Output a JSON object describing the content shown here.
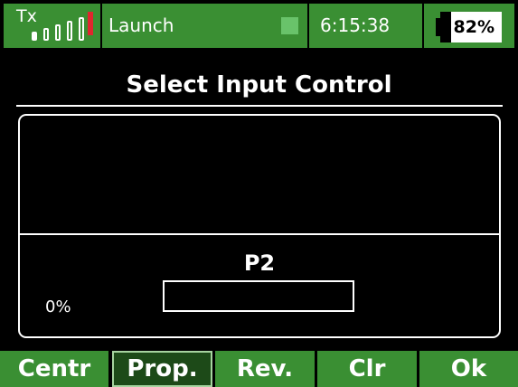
{
  "status_bar": {
    "tx_label": "Tx",
    "signal": {
      "level": 4,
      "bars": 5,
      "alert_color": "#e0262e"
    },
    "model_name": "Launch",
    "model_indicator_color": "#69c36a",
    "time": "6:15:38",
    "battery": {
      "percent_label": "82%",
      "level": 0.82
    }
  },
  "title": "Select Input Control",
  "control": {
    "name": "P2",
    "percent_label": "0%",
    "meter_level": 0.0
  },
  "softkeys": [
    {
      "label": "Centr",
      "selected": false
    },
    {
      "label": "Prop.",
      "selected": true
    },
    {
      "label": "Rev.",
      "selected": false
    },
    {
      "label": "Clr",
      "selected": false
    },
    {
      "label": "Ok",
      "selected": false
    }
  ],
  "colors": {
    "bar_green": "#3a8f33",
    "selected_key": "#1d4a18",
    "background": "#000000",
    "foreground": "#ffffff"
  }
}
